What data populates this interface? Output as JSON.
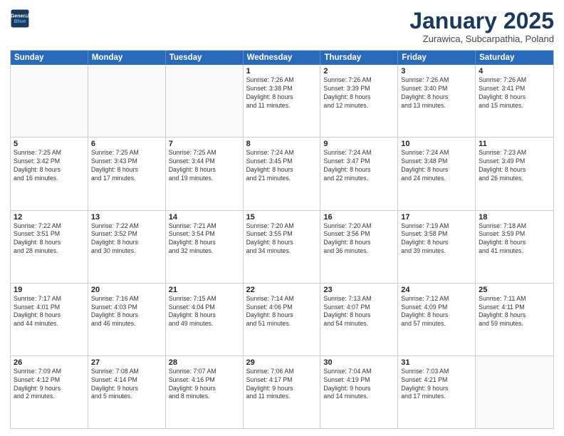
{
  "logo": {
    "line1": "General",
    "line2": "Blue"
  },
  "header": {
    "month": "January 2025",
    "location": "Zurawica, Subcarpathia, Poland"
  },
  "days": [
    "Sunday",
    "Monday",
    "Tuesday",
    "Wednesday",
    "Thursday",
    "Friday",
    "Saturday"
  ],
  "rows": [
    [
      {
        "day": "",
        "text": ""
      },
      {
        "day": "",
        "text": ""
      },
      {
        "day": "",
        "text": ""
      },
      {
        "day": "1",
        "text": "Sunrise: 7:26 AM\nSunset: 3:38 PM\nDaylight: 8 hours\nand 11 minutes."
      },
      {
        "day": "2",
        "text": "Sunrise: 7:26 AM\nSunset: 3:39 PM\nDaylight: 8 hours\nand 12 minutes."
      },
      {
        "day": "3",
        "text": "Sunrise: 7:26 AM\nSunset: 3:40 PM\nDaylight: 8 hours\nand 13 minutes."
      },
      {
        "day": "4",
        "text": "Sunrise: 7:26 AM\nSunset: 3:41 PM\nDaylight: 8 hours\nand 15 minutes."
      }
    ],
    [
      {
        "day": "5",
        "text": "Sunrise: 7:25 AM\nSunset: 3:42 PM\nDaylight: 8 hours\nand 16 minutes."
      },
      {
        "day": "6",
        "text": "Sunrise: 7:25 AM\nSunset: 3:43 PM\nDaylight: 8 hours\nand 17 minutes."
      },
      {
        "day": "7",
        "text": "Sunrise: 7:25 AM\nSunset: 3:44 PM\nDaylight: 8 hours\nand 19 minutes."
      },
      {
        "day": "8",
        "text": "Sunrise: 7:24 AM\nSunset: 3:45 PM\nDaylight: 8 hours\nand 21 minutes."
      },
      {
        "day": "9",
        "text": "Sunrise: 7:24 AM\nSunset: 3:47 PM\nDaylight: 8 hours\nand 22 minutes."
      },
      {
        "day": "10",
        "text": "Sunrise: 7:24 AM\nSunset: 3:48 PM\nDaylight: 8 hours\nand 24 minutes."
      },
      {
        "day": "11",
        "text": "Sunrise: 7:23 AM\nSunset: 3:49 PM\nDaylight: 8 hours\nand 26 minutes."
      }
    ],
    [
      {
        "day": "12",
        "text": "Sunrise: 7:22 AM\nSunset: 3:51 PM\nDaylight: 8 hours\nand 28 minutes."
      },
      {
        "day": "13",
        "text": "Sunrise: 7:22 AM\nSunset: 3:52 PM\nDaylight: 8 hours\nand 30 minutes."
      },
      {
        "day": "14",
        "text": "Sunrise: 7:21 AM\nSunset: 3:54 PM\nDaylight: 8 hours\nand 32 minutes."
      },
      {
        "day": "15",
        "text": "Sunrise: 7:20 AM\nSunset: 3:55 PM\nDaylight: 8 hours\nand 34 minutes."
      },
      {
        "day": "16",
        "text": "Sunrise: 7:20 AM\nSunset: 3:56 PM\nDaylight: 8 hours\nand 36 minutes."
      },
      {
        "day": "17",
        "text": "Sunrise: 7:19 AM\nSunset: 3:58 PM\nDaylight: 8 hours\nand 39 minutes."
      },
      {
        "day": "18",
        "text": "Sunrise: 7:18 AM\nSunset: 3:59 PM\nDaylight: 8 hours\nand 41 minutes."
      }
    ],
    [
      {
        "day": "19",
        "text": "Sunrise: 7:17 AM\nSunset: 4:01 PM\nDaylight: 8 hours\nand 44 minutes."
      },
      {
        "day": "20",
        "text": "Sunrise: 7:16 AM\nSunset: 4:03 PM\nDaylight: 8 hours\nand 46 minutes."
      },
      {
        "day": "21",
        "text": "Sunrise: 7:15 AM\nSunset: 4:04 PM\nDaylight: 8 hours\nand 49 minutes."
      },
      {
        "day": "22",
        "text": "Sunrise: 7:14 AM\nSunset: 4:06 PM\nDaylight: 8 hours\nand 51 minutes."
      },
      {
        "day": "23",
        "text": "Sunrise: 7:13 AM\nSunset: 4:07 PM\nDaylight: 8 hours\nand 54 minutes."
      },
      {
        "day": "24",
        "text": "Sunrise: 7:12 AM\nSunset: 4:09 PM\nDaylight: 8 hours\nand 57 minutes."
      },
      {
        "day": "25",
        "text": "Sunrise: 7:11 AM\nSunset: 4:11 PM\nDaylight: 8 hours\nand 59 minutes."
      }
    ],
    [
      {
        "day": "26",
        "text": "Sunrise: 7:09 AM\nSunset: 4:12 PM\nDaylight: 9 hours\nand 2 minutes."
      },
      {
        "day": "27",
        "text": "Sunrise: 7:08 AM\nSunset: 4:14 PM\nDaylight: 9 hours\nand 5 minutes."
      },
      {
        "day": "28",
        "text": "Sunrise: 7:07 AM\nSunset: 4:16 PM\nDaylight: 9 hours\nand 8 minutes."
      },
      {
        "day": "29",
        "text": "Sunrise: 7:06 AM\nSunset: 4:17 PM\nDaylight: 9 hours\nand 11 minutes."
      },
      {
        "day": "30",
        "text": "Sunrise: 7:04 AM\nSunset: 4:19 PM\nDaylight: 9 hours\nand 14 minutes."
      },
      {
        "day": "31",
        "text": "Sunrise: 7:03 AM\nSunset: 4:21 PM\nDaylight: 9 hours\nand 17 minutes."
      },
      {
        "day": "",
        "text": ""
      }
    ]
  ]
}
